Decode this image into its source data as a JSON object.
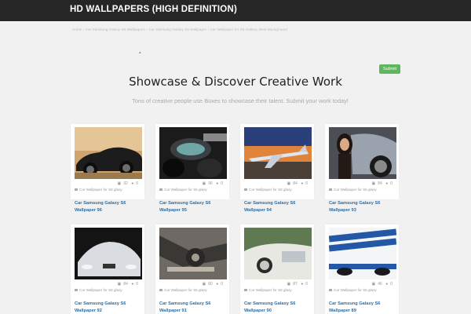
{
  "header": {
    "title": "HD WALLPAPERS (HIGH DEFINITION)"
  },
  "breadcrumb": "Home › Car Samsung Galaxy S6 Wallpapers › Car Samsung Galaxy S6 Wallpaper › Car Wallpaper for S6 Gallery, Best Background",
  "tiny_mark": "▴",
  "submit_label": "Submit",
  "hero": {
    "title": "Showcase & Discover Creative Work",
    "subtitle": "Tons of creative people use Boxes to showcase their talent. Submit your work today!"
  },
  "colors": {
    "topbar": "#262626",
    "accent_link": "#2a6fa8",
    "submit": "#5cb85c",
    "background": "#f1f1f1"
  },
  "cards": [
    {
      "views": "92",
      "comments": "0",
      "category": "Car Wallpaper for S6 glaxy",
      "title": "Car Samsung Galaxy S6 Wallpaper 96",
      "image": "black sports car side"
    },
    {
      "views": "96",
      "comments": "0",
      "category": "Car Wallpaper for S6 glaxy",
      "title": "Car Samsung Galaxy S6 Wallpaper 95",
      "image": "motorcycle dashboard"
    },
    {
      "views": "84",
      "comments": "0",
      "category": "Car Wallpaper for S6 glaxy",
      "title": "Car Samsung Galaxy S6 Wallpaper 94",
      "image": "airplane on tarmac"
    },
    {
      "views": "84",
      "comments": "0",
      "category": "Car Wallpaper for S6 glaxy",
      "title": "Car Samsung Galaxy S6 Wallpaper 93",
      "image": "woman with silver car"
    },
    {
      "views": "84",
      "comments": "0",
      "category": "Car Wallpaper for S6 glaxy",
      "title": "Car Samsung Galaxy S6 Wallpaper 92",
      "image": "white BMW front"
    },
    {
      "views": "80",
      "comments": "0",
      "category": "Car Wallpaper for S6 glaxy",
      "title": "Car Samsung Galaxy S6 Wallpaper 91",
      "image": "motorcycle closeup"
    },
    {
      "views": "87",
      "comments": "0",
      "category": "Car Wallpaper for S6 glaxy",
      "title": "Car Samsung Galaxy S6 Wallpaper 90",
      "image": "classic white car"
    },
    {
      "views": "46",
      "comments": "0",
      "category": "Car Wallpaper for S6 glaxy",
      "title": "Car Samsung Galaxy S6 Wallpaper 89",
      "image": "white car blue stripes"
    }
  ]
}
